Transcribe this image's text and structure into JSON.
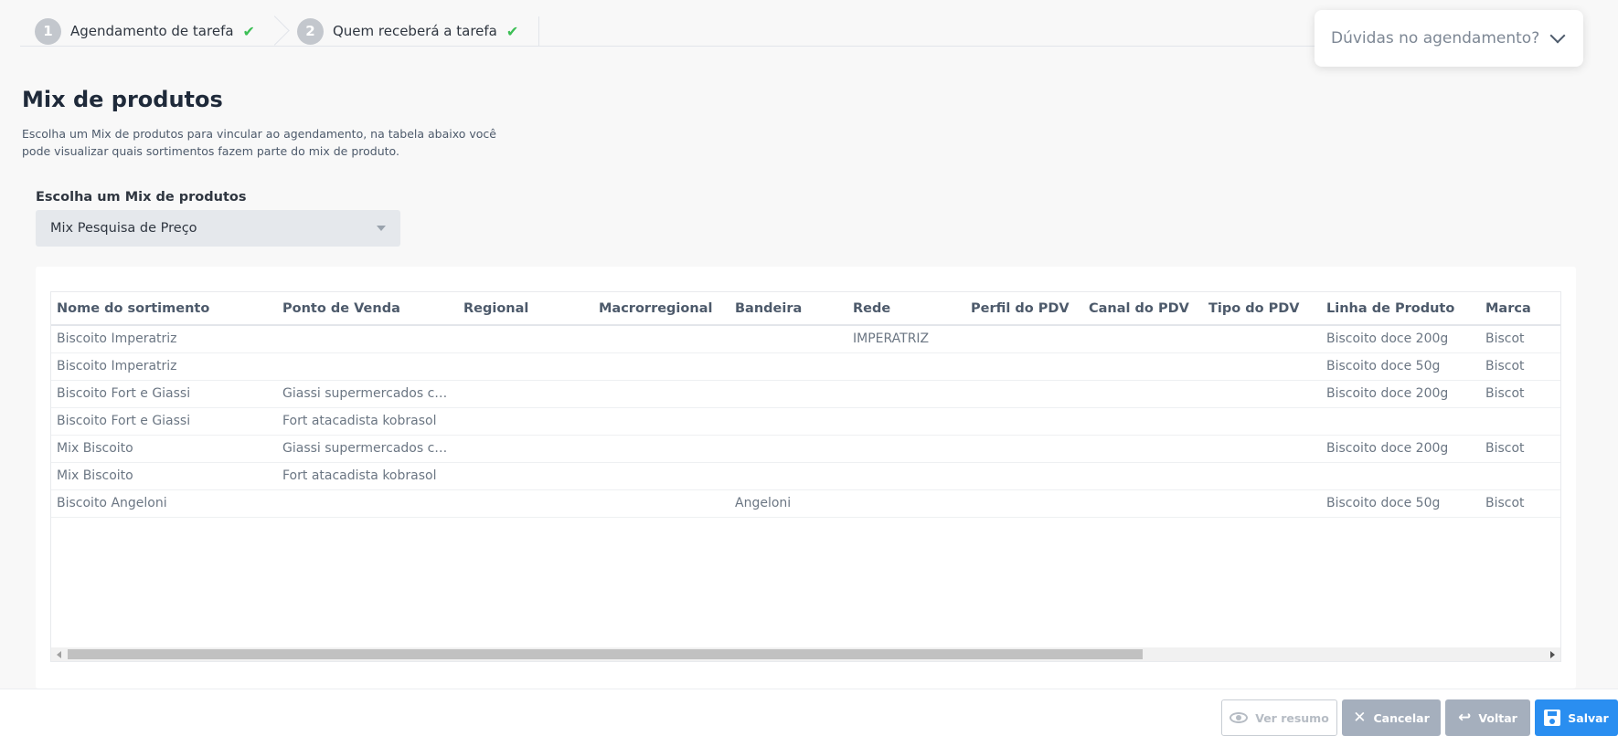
{
  "stepper": {
    "steps": [
      {
        "number": "1",
        "label": "Agendamento de tarefa",
        "done": true
      },
      {
        "number": "2",
        "label": "Quem receberá a tarefa",
        "done": true
      }
    ],
    "check_icon": "check-icon"
  },
  "help": {
    "label": "Dúvidas no agendamento?",
    "icon": "chevron-down-icon"
  },
  "main": {
    "title": "Mix de produtos",
    "description": "Escolha um Mix de produtos para vincular ao agendamento, na tabela abaixo você pode visualizar quais sortimentos fazem parte do mix de produto."
  },
  "mix_select": {
    "label": "Escolha um Mix de produtos",
    "value": "Mix Pesquisa de Preço"
  },
  "table": {
    "columns": [
      "Nome do sortimento",
      "Ponto de Venda",
      "Regional",
      "Macrorregional",
      "Bandeira",
      "Rede",
      "Perfil do PDV",
      "Canal do PDV",
      "Tipo do PDV",
      "Linha de Produto",
      "Marca"
    ],
    "rows": [
      [
        "Biscoito Imperatriz",
        "",
        "",
        "",
        "",
        "IMPERATRIZ",
        "",
        "",
        "",
        "Biscoito doce 200g",
        "Biscot"
      ],
      [
        "Biscoito Imperatriz",
        "",
        "",
        "",
        "",
        "",
        "",
        "",
        "",
        "Biscoito doce 50g",
        "Biscot"
      ],
      [
        "Biscoito Fort e Giassi",
        "Giassi supermercados cam...",
        "",
        "",
        "",
        "",
        "",
        "",
        "",
        "Biscoito doce 200g",
        "Biscot"
      ],
      [
        "Biscoito Fort e Giassi",
        "Fort atacadista kobrasol",
        "",
        "",
        "",
        "",
        "",
        "",
        "",
        "",
        ""
      ],
      [
        "Mix Biscoito",
        "Giassi supermercados cam...",
        "",
        "",
        "",
        "",
        "",
        "",
        "",
        "Biscoito doce 200g",
        "Biscot"
      ],
      [
        "Mix Biscoito",
        "Fort atacadista kobrasol",
        "",
        "",
        "",
        "",
        "",
        "",
        "",
        "",
        ""
      ],
      [
        "Biscoito Angeloni",
        "",
        "",
        "",
        "Angeloni",
        "",
        "",
        "",
        "",
        "Biscoito doce 50g",
        "Biscot"
      ]
    ]
  },
  "footer": {
    "ver_resumo": "Ver resumo",
    "cancelar": "Cancelar",
    "voltar": "Voltar",
    "salvar": "Salvar"
  },
  "colors": {
    "primary": "#2a8ef0",
    "secondary_button": "#a5afbd",
    "success": "#3cbf55"
  }
}
